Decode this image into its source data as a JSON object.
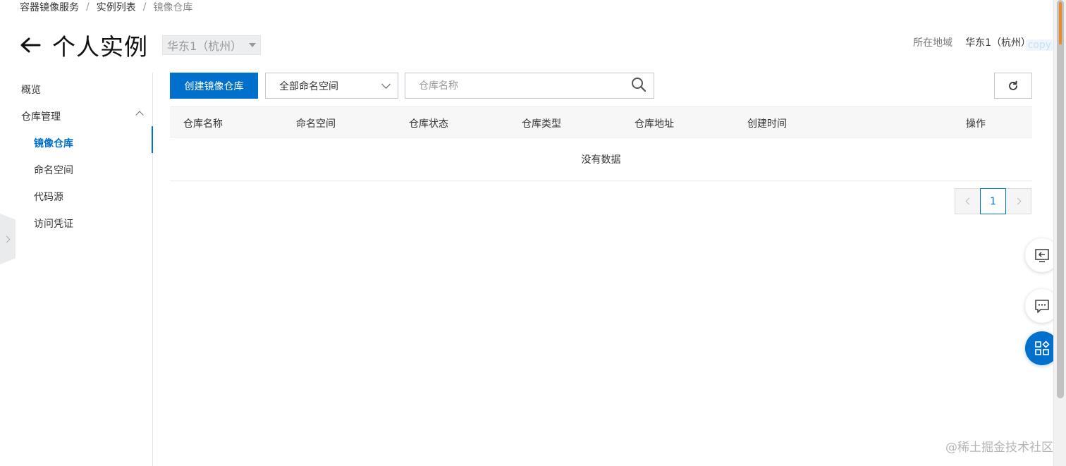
{
  "breadcrumb": {
    "items": [
      "容器镜像服务",
      "实例列表",
      "镜像仓库"
    ],
    "separator": "/"
  },
  "header": {
    "back_icon": "arrow-left-icon",
    "title": "个人实例",
    "region_select": "华东1（杭州）"
  },
  "region_info": {
    "label": "所在地域",
    "value": "华东1（杭州）",
    "copy_label": "copy"
  },
  "sidebar": {
    "overview": "概览",
    "repo_mgmt": "仓库管理",
    "items": [
      {
        "label": "镜像仓库",
        "active": true
      },
      {
        "label": "命名空间",
        "active": false
      },
      {
        "label": "代码源",
        "active": false
      },
      {
        "label": "访问凭证",
        "active": false
      }
    ]
  },
  "toolbar": {
    "create_label": "创建镜像仓库",
    "namespace_select": "全部命名空间",
    "search_placeholder": "仓库名称",
    "search_value": ""
  },
  "table": {
    "columns": [
      "仓库名称",
      "命名空间",
      "仓库状态",
      "仓库类型",
      "仓库地址",
      "创建时间",
      "操作"
    ],
    "rows": [],
    "empty_text": "没有数据"
  },
  "pagination": {
    "current_page": "1"
  },
  "float_buttons": [
    "feedback-icon",
    "chat-icon",
    "apps-icon"
  ],
  "watermark": "@稀土掘金技术社区",
  "colors": {
    "accent": "#0070cc"
  }
}
